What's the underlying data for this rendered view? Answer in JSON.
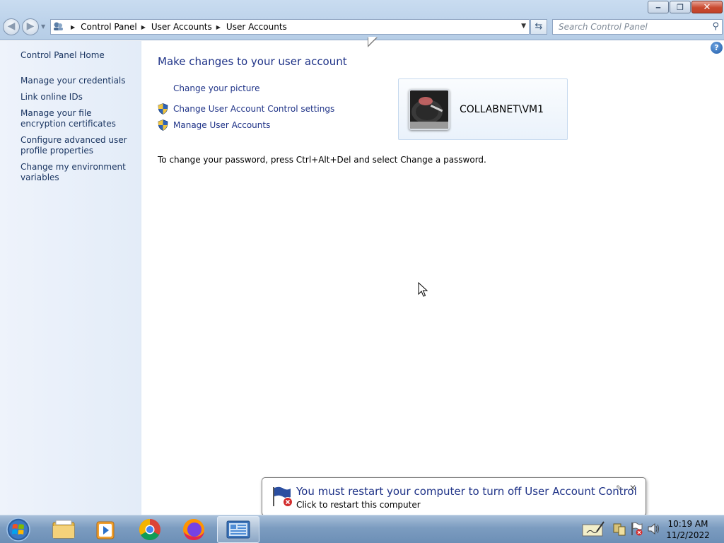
{
  "window": {
    "buttons": {
      "minimize": "‒",
      "restore": "❐",
      "close": "✕"
    }
  },
  "address_bar": {
    "crumbs": [
      "Control Panel",
      "User Accounts",
      "User Accounts"
    ]
  },
  "search": {
    "placeholder": "Search Control Panel"
  },
  "left_pane": {
    "links": [
      "Control Panel Home",
      "Manage your credentials",
      "Link online IDs",
      "Manage your file encryption certificates",
      "Configure advanced user profile properties",
      "Change my environment variables"
    ]
  },
  "main": {
    "heading": "Make changes to your user account",
    "tasks": [
      "Change your picture",
      "Change User Account Control settings",
      "Manage User Accounts"
    ],
    "password_note": "To change your password, press Ctrl+Alt+Del and select Change a password.",
    "user": {
      "name": "COLLABNET\\VM1"
    }
  },
  "balloon": {
    "title": "You must restart your computer to turn off User Account Control",
    "subtitle": "Click to restart this computer"
  },
  "clock": {
    "time": "10:19 AM",
    "date": "11/2/2022"
  },
  "taskbar": {
    "icons": [
      "file-explorer-icon",
      "media-player-icon",
      "chrome-icon",
      "firefox-icon",
      "control-panel-icon"
    ]
  }
}
